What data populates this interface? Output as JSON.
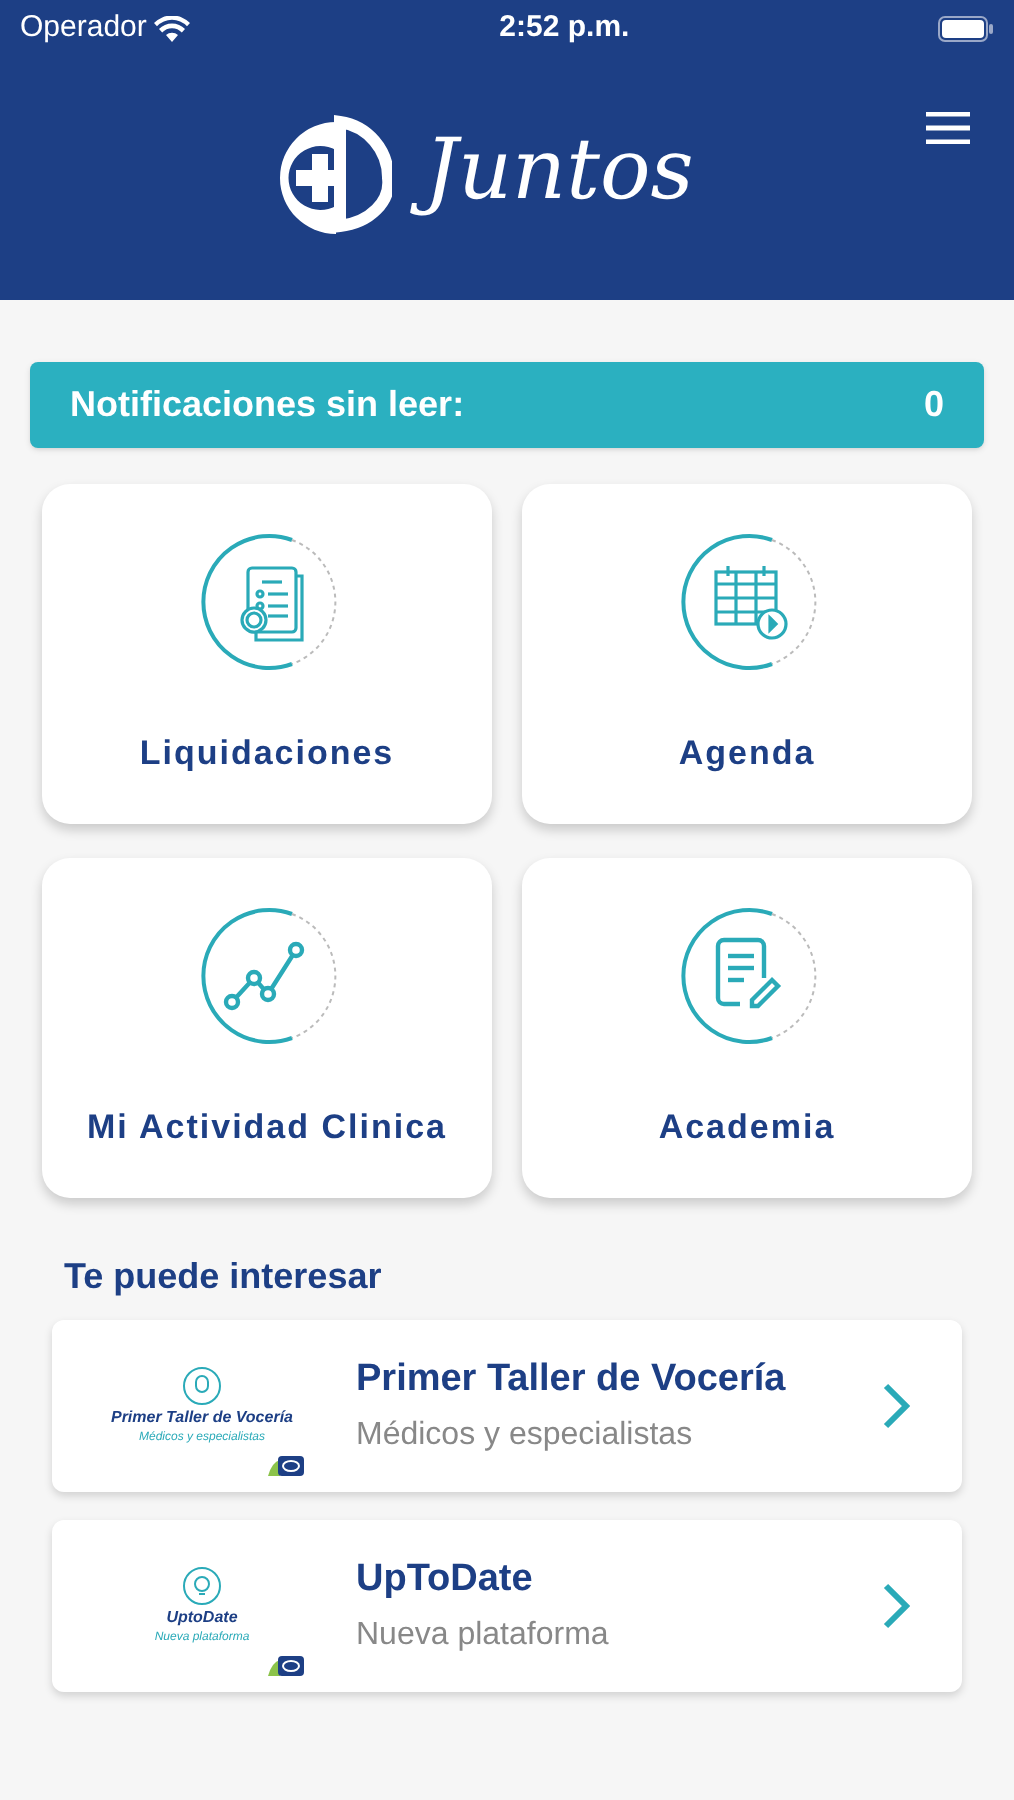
{
  "status_bar": {
    "carrier": "Operador",
    "time": "2:52 p.m."
  },
  "header": {
    "logo_text": "Juntos"
  },
  "notifications": {
    "label": "Notificaciones sin leer:",
    "count": "0"
  },
  "tiles": [
    {
      "kind": "invoice",
      "label": "Liquidaciones"
    },
    {
      "kind": "calendar",
      "label": "Agenda"
    },
    {
      "kind": "chart",
      "label": "Mi Actividad Clinica"
    },
    {
      "kind": "document",
      "label": "Academia"
    }
  ],
  "suggestions": {
    "title": "Te puede interesar",
    "items": [
      {
        "kind": "mic",
        "thumb_title": "Primer Taller de Vocería",
        "thumb_subtitle": "Médicos y especialistas",
        "title": "Primer Taller de Vocería",
        "subtitle": "Médicos y especialistas"
      },
      {
        "kind": "bulb",
        "thumb_title": "UptoDate",
        "thumb_subtitle": "Nueva plataforma",
        "title": "UpToDate",
        "subtitle": "Nueva plataforma"
      }
    ]
  }
}
